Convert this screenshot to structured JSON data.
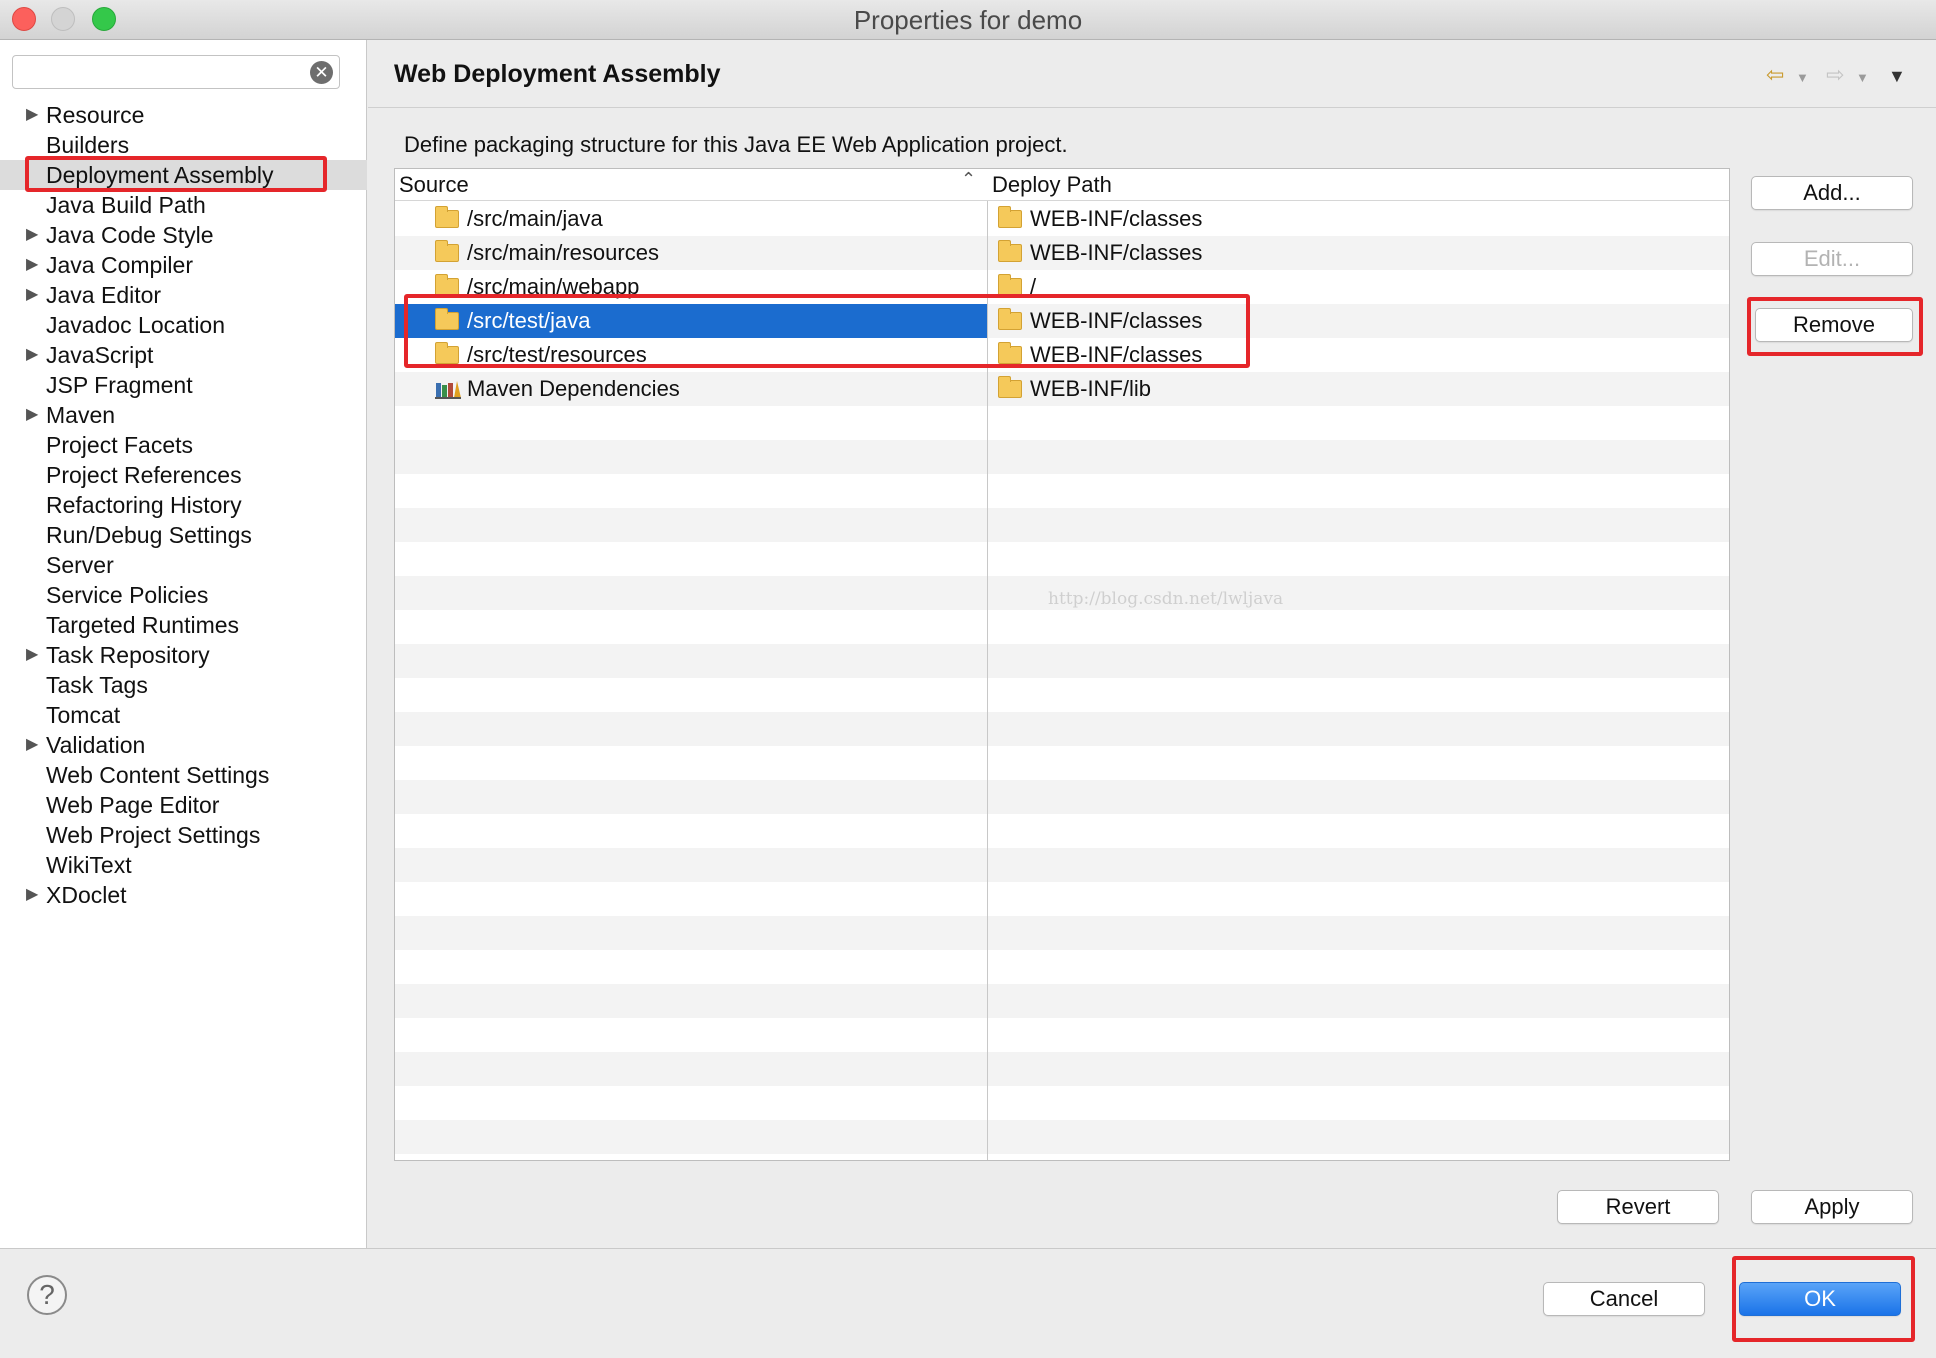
{
  "window": {
    "title": "Properties for demo"
  },
  "nav": {
    "filter_value": "",
    "items": [
      {
        "label": "Resource",
        "expandable": true
      },
      {
        "label": "Builders",
        "expandable": false
      },
      {
        "label": "Deployment Assembly",
        "expandable": false,
        "selected": true
      },
      {
        "label": "Java Build Path",
        "expandable": false
      },
      {
        "label": "Java Code Style",
        "expandable": true
      },
      {
        "label": "Java Compiler",
        "expandable": true
      },
      {
        "label": "Java Editor",
        "expandable": true
      },
      {
        "label": "Javadoc Location",
        "expandable": false
      },
      {
        "label": "JavaScript",
        "expandable": true
      },
      {
        "label": "JSP Fragment",
        "expandable": false
      },
      {
        "label": "Maven",
        "expandable": true
      },
      {
        "label": "Project Facets",
        "expandable": false
      },
      {
        "label": "Project References",
        "expandable": false
      },
      {
        "label": "Refactoring History",
        "expandable": false
      },
      {
        "label": "Run/Debug Settings",
        "expandable": false
      },
      {
        "label": "Server",
        "expandable": false
      },
      {
        "label": "Service Policies",
        "expandable": false
      },
      {
        "label": "Targeted Runtimes",
        "expandable": false
      },
      {
        "label": "Task Repository",
        "expandable": true
      },
      {
        "label": "Task Tags",
        "expandable": false
      },
      {
        "label": "Tomcat",
        "expandable": false
      },
      {
        "label": "Validation",
        "expandable": true
      },
      {
        "label": "Web Content Settings",
        "expandable": false
      },
      {
        "label": "Web Page Editor",
        "expandable": false
      },
      {
        "label": "Web Project Settings",
        "expandable": false
      },
      {
        "label": "WikiText",
        "expandable": false
      },
      {
        "label": "XDoclet",
        "expandable": true
      }
    ]
  },
  "panel": {
    "title": "Web Deployment Assembly",
    "description": "Define packaging structure for this Java EE Web Application project.",
    "table": {
      "columns": {
        "source": "Source",
        "deploy_path": "Deploy Path"
      },
      "rows": [
        {
          "source": "/src/main/java",
          "deploy_path": "WEB-INF/classes",
          "icon": "folder-icon"
        },
        {
          "source": "/src/main/resources",
          "deploy_path": "WEB-INF/classes",
          "icon": "folder-icon"
        },
        {
          "source": "/src/main/webapp",
          "deploy_path": "/",
          "icon": "folder-icon"
        },
        {
          "source": "/src/test/java",
          "deploy_path": "WEB-INF/classes",
          "icon": "folder-icon",
          "selected": true
        },
        {
          "source": "/src/test/resources",
          "deploy_path": "WEB-INF/classes",
          "icon": "folder-icon"
        },
        {
          "source": "Maven Dependencies",
          "deploy_path": "WEB-INF/lib",
          "icon": "library-icon"
        }
      ],
      "watermark": "http://blog.csdn.net/lwljava"
    },
    "buttons": {
      "add": "Add...",
      "edit": "Edit...",
      "remove": "Remove",
      "revert": "Revert",
      "apply": "Apply"
    }
  },
  "footer": {
    "cancel": "Cancel",
    "ok": "OK"
  },
  "colors": {
    "selection": "#1b6ccf",
    "highlight": "#e5262a",
    "primary_button": "#1a73e8"
  }
}
